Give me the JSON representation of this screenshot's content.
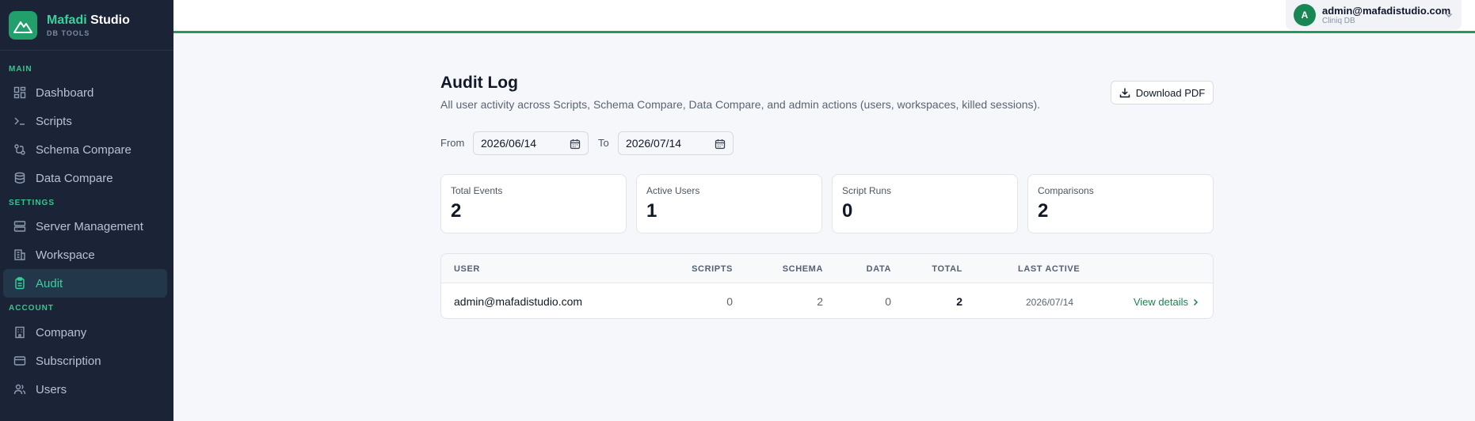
{
  "brand": {
    "name_accent": "Mafadi",
    "name_rest": " Studio",
    "subtitle": "DB TOOLS"
  },
  "sidebar": {
    "sections": [
      {
        "label": "MAIN"
      },
      {
        "label": "SETTINGS"
      },
      {
        "label": "ACCOUNT"
      }
    ],
    "items": [
      {
        "label": "Dashboard",
        "icon": "dashboard-icon"
      },
      {
        "label": "Scripts",
        "icon": "terminal-icon"
      },
      {
        "label": "Schema Compare",
        "icon": "git-compare-icon"
      },
      {
        "label": "Data Compare",
        "icon": "database-icon"
      },
      {
        "label": "Server Management",
        "icon": "server-icon"
      },
      {
        "label": "Workspace",
        "icon": "building-icon"
      },
      {
        "label": "Audit",
        "icon": "clipboard-icon",
        "active": true
      },
      {
        "label": "Company",
        "icon": "office-icon"
      },
      {
        "label": "Subscription",
        "icon": "credit-card-icon"
      },
      {
        "label": "Users",
        "icon": "users-icon"
      }
    ]
  },
  "user": {
    "initial": "A",
    "email": "admin@mafadistudio.com",
    "db": "Cliniq DB"
  },
  "page": {
    "title": "Audit Log",
    "subtitle": "All user activity across Scripts, Schema Compare, Data Compare, and admin actions (users, workspaces, killed sessions).",
    "download_label": "Download PDF"
  },
  "filters": {
    "from_label": "From",
    "from_value": "2026/06/14",
    "to_label": "To",
    "to_value": "2026/07/14"
  },
  "stats": [
    {
      "label": "Total Events",
      "value": "2"
    },
    {
      "label": "Active Users",
      "value": "1"
    },
    {
      "label": "Script Runs",
      "value": "0"
    },
    {
      "label": "Comparisons",
      "value": "2"
    }
  ],
  "table": {
    "headers": [
      "USER",
      "SCRIPTS",
      "SCHEMA",
      "DATA",
      "TOTAL",
      "LAST ACTIVE"
    ],
    "rows": [
      {
        "user": "admin@mafadistudio.com",
        "scripts": "0",
        "schema": "2",
        "data": "0",
        "total": "2",
        "last_active": "2026/07/14",
        "action": "View details"
      }
    ]
  },
  "colors": {
    "accent": "#22a06b",
    "sidebar_bg": "#1b2437",
    "link": "#17864f"
  }
}
